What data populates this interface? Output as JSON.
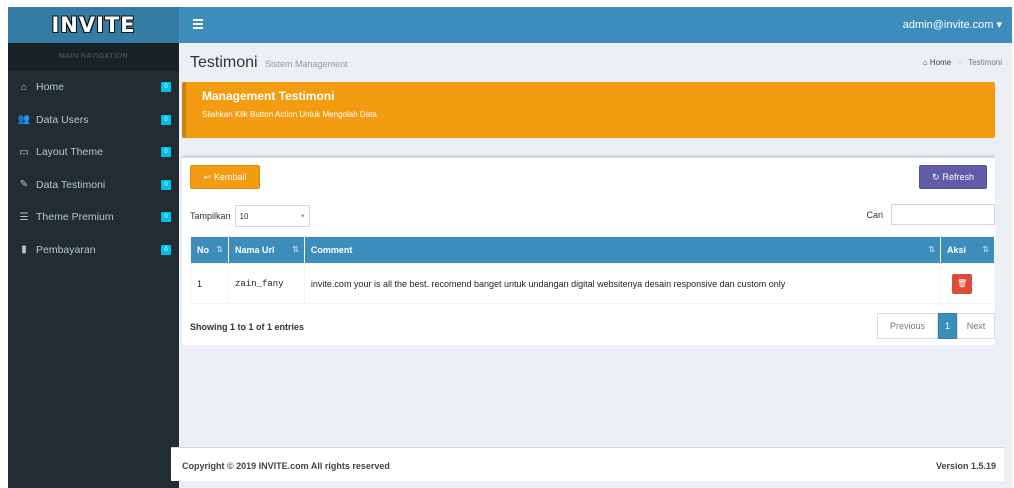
{
  "app": {
    "logo": "INVITE",
    "user": "admin@invite.com ▾"
  },
  "sidebar": {
    "header": "MAIN NAVIGATION",
    "items": [
      {
        "label": "Home",
        "icon": "home-icon",
        "glyph": "⌂",
        "badge": "0"
      },
      {
        "label": "Data Users",
        "icon": "users-icon",
        "glyph": "👥",
        "badge": "0"
      },
      {
        "label": "Layout Theme",
        "icon": "monitor-icon",
        "glyph": "▭",
        "badge": "0"
      },
      {
        "label": "Data Testimoni",
        "icon": "edit-icon",
        "glyph": "✎",
        "badge": "0"
      },
      {
        "label": "Theme Premium",
        "icon": "list-icon",
        "glyph": "☰",
        "badge": "0"
      },
      {
        "label": "Pembayaran",
        "icon": "file-icon",
        "glyph": "▮",
        "badge": "0"
      }
    ]
  },
  "header": {
    "title": "Testimoni",
    "subtitle": "Sistem Management",
    "breadcrumb_home": "Home",
    "breadcrumb_current": "Testimoni"
  },
  "callout": {
    "title": "Management Testimoni",
    "text": "Silahkan Klik Button Action Untuk Mengolah Data"
  },
  "box": {
    "kembali_label": "Kembali",
    "refresh_label": "Refresh",
    "length_label": "Tampilkan",
    "length_value": "10",
    "search_label": "Cari",
    "search_value": "",
    "columns": [
      "No",
      "Nama Url",
      "Comment",
      "Aksi"
    ],
    "rows": [
      {
        "no": "1",
        "url": "zain_fany",
        "comment": "invite.com your is all the best. recomend banget untuk undangan digital websitenya desain responsive dan custom only"
      }
    ],
    "info": "Showing 1 to 1 of 1 entries",
    "pager": {
      "prev": "Previous",
      "page": "1",
      "next": "Next"
    }
  },
  "footer": {
    "copyright": "Copyright © 2019 INVITE.com All rights reserved",
    "version": "Version 1.5.19"
  },
  "colors": {
    "primary": "#3c8dbc",
    "warning": "#f39c12",
    "purple": "#605ca8",
    "danger": "#dd4b39",
    "sidebar": "#222d32"
  }
}
